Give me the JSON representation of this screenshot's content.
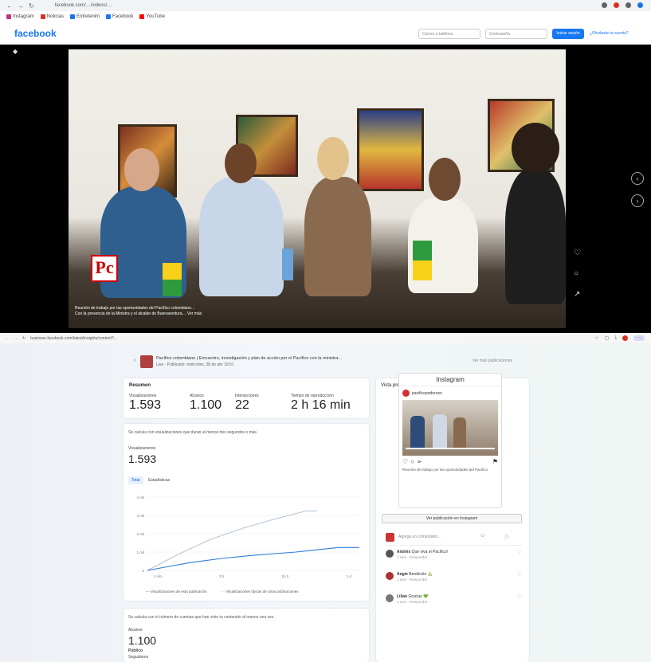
{
  "top_browser": {
    "url": "facebook.com/…/videos/…",
    "bookmarks": [
      "Instagram",
      "Noticias",
      "Entretenim",
      "Facebook",
      "YouTube"
    ]
  },
  "facebook": {
    "logo": "facebook",
    "email_placeholder": "Correo o teléfono",
    "password_placeholder": "Contraseña",
    "login_label": "Iniciar sesión",
    "register_label": "¿Olvidaste tu cuenta?"
  },
  "video": {
    "logo_text": "Pc",
    "caption_line1": "Reunión de trabajo por las oportunidades del Pacífico colombiano…",
    "caption_line2": "Con la presencia de la Ministra y el alcalde de Buenaventura… Ver más"
  },
  "bottom_browser": {
    "url": "business.facebook.com/latest/insights/content?…"
  },
  "post": {
    "title": "Pacífico colombiano | Encuentro, investigación y plan de acción por el Pacífico con la ministra…",
    "subtitle": "Live · Publicado: miércoles, 28 de abr 19:51",
    "right_link": "Ver más publicaciones"
  },
  "summary": {
    "title": "Resumen",
    "metrics": [
      {
        "label": "Visualizaciones",
        "value": "1.593"
      },
      {
        "label": "Alcance",
        "value": "1.100"
      },
      {
        "label": "Interacciones",
        "value": "22"
      },
      {
        "label": "Tiempo de reproducción",
        "value": "2 h 16 min"
      }
    ]
  },
  "views_section": {
    "description": "Se calcula con visualizaciones que duran al menos tres segundos o más.",
    "metric_label": "Visualizaciones",
    "metric_value": "1.593",
    "tabs": [
      "Total",
      "Estadísticas"
    ],
    "legend_a": "Visualizaciones de esta publicación",
    "legend_b": "Visualizaciones típicas de otras publicaciones"
  },
  "chart_data": {
    "type": "line",
    "x": [
      "1 min",
      "3 h",
      "15 h",
      "1 d"
    ],
    "yticks": [
      "0",
      "1 mil",
      "2 mil",
      "3 mil",
      "4 mil"
    ],
    "ylim": [
      0,
      4000
    ],
    "series": [
      {
        "name": "Visualizaciones de esta publicación",
        "color": "#2f7bd9",
        "points": [
          [
            0,
            0
          ],
          [
            0.2,
            420
          ],
          [
            0.35,
            650
          ],
          [
            0.5,
            820
          ],
          [
            0.7,
            1000
          ],
          [
            0.9,
            1250
          ],
          [
            1.0,
            1250
          ]
        ]
      },
      {
        "name": "Visualizaciones típicas de otras publicaciones",
        "color": "#b8c6d8",
        "points": [
          [
            0,
            0
          ],
          [
            0.15,
            900
          ],
          [
            0.3,
            1700
          ],
          [
            0.45,
            2300
          ],
          [
            0.6,
            2800
          ],
          [
            0.75,
            3250
          ],
          [
            0.8,
            3250
          ]
        ]
      }
    ]
  },
  "reach_section": {
    "description": "Se calcula con el número de cuentas que han visto tu contenido al menos una vez.",
    "metric_label": "Alcance",
    "metric_value": "1.100",
    "sub_label": "Público",
    "sub_label2": "Seguidores"
  },
  "feed_preview": {
    "title": "Vista previa del feed",
    "ig_header": "Instagram",
    "ig_user": "pacificopoderoso",
    "ig_caption": "Reunión de trabajo por las oportunidades del Pacífico",
    "ig_button": "Ver publicación en Instagram",
    "comment_placeholder": "Agrega un comentario…",
    "comments": [
      {
        "user": "Andrés",
        "text": "Que viva el Pacífico!",
        "meta": "1 sem · Responder"
      },
      {
        "user": "Angie",
        "text": "Bendición 🙏",
        "meta": "1 sem · Responder"
      },
      {
        "user": "Lilian",
        "text": "Gracias 💚",
        "meta": "1 sem · Responder"
      }
    ]
  }
}
